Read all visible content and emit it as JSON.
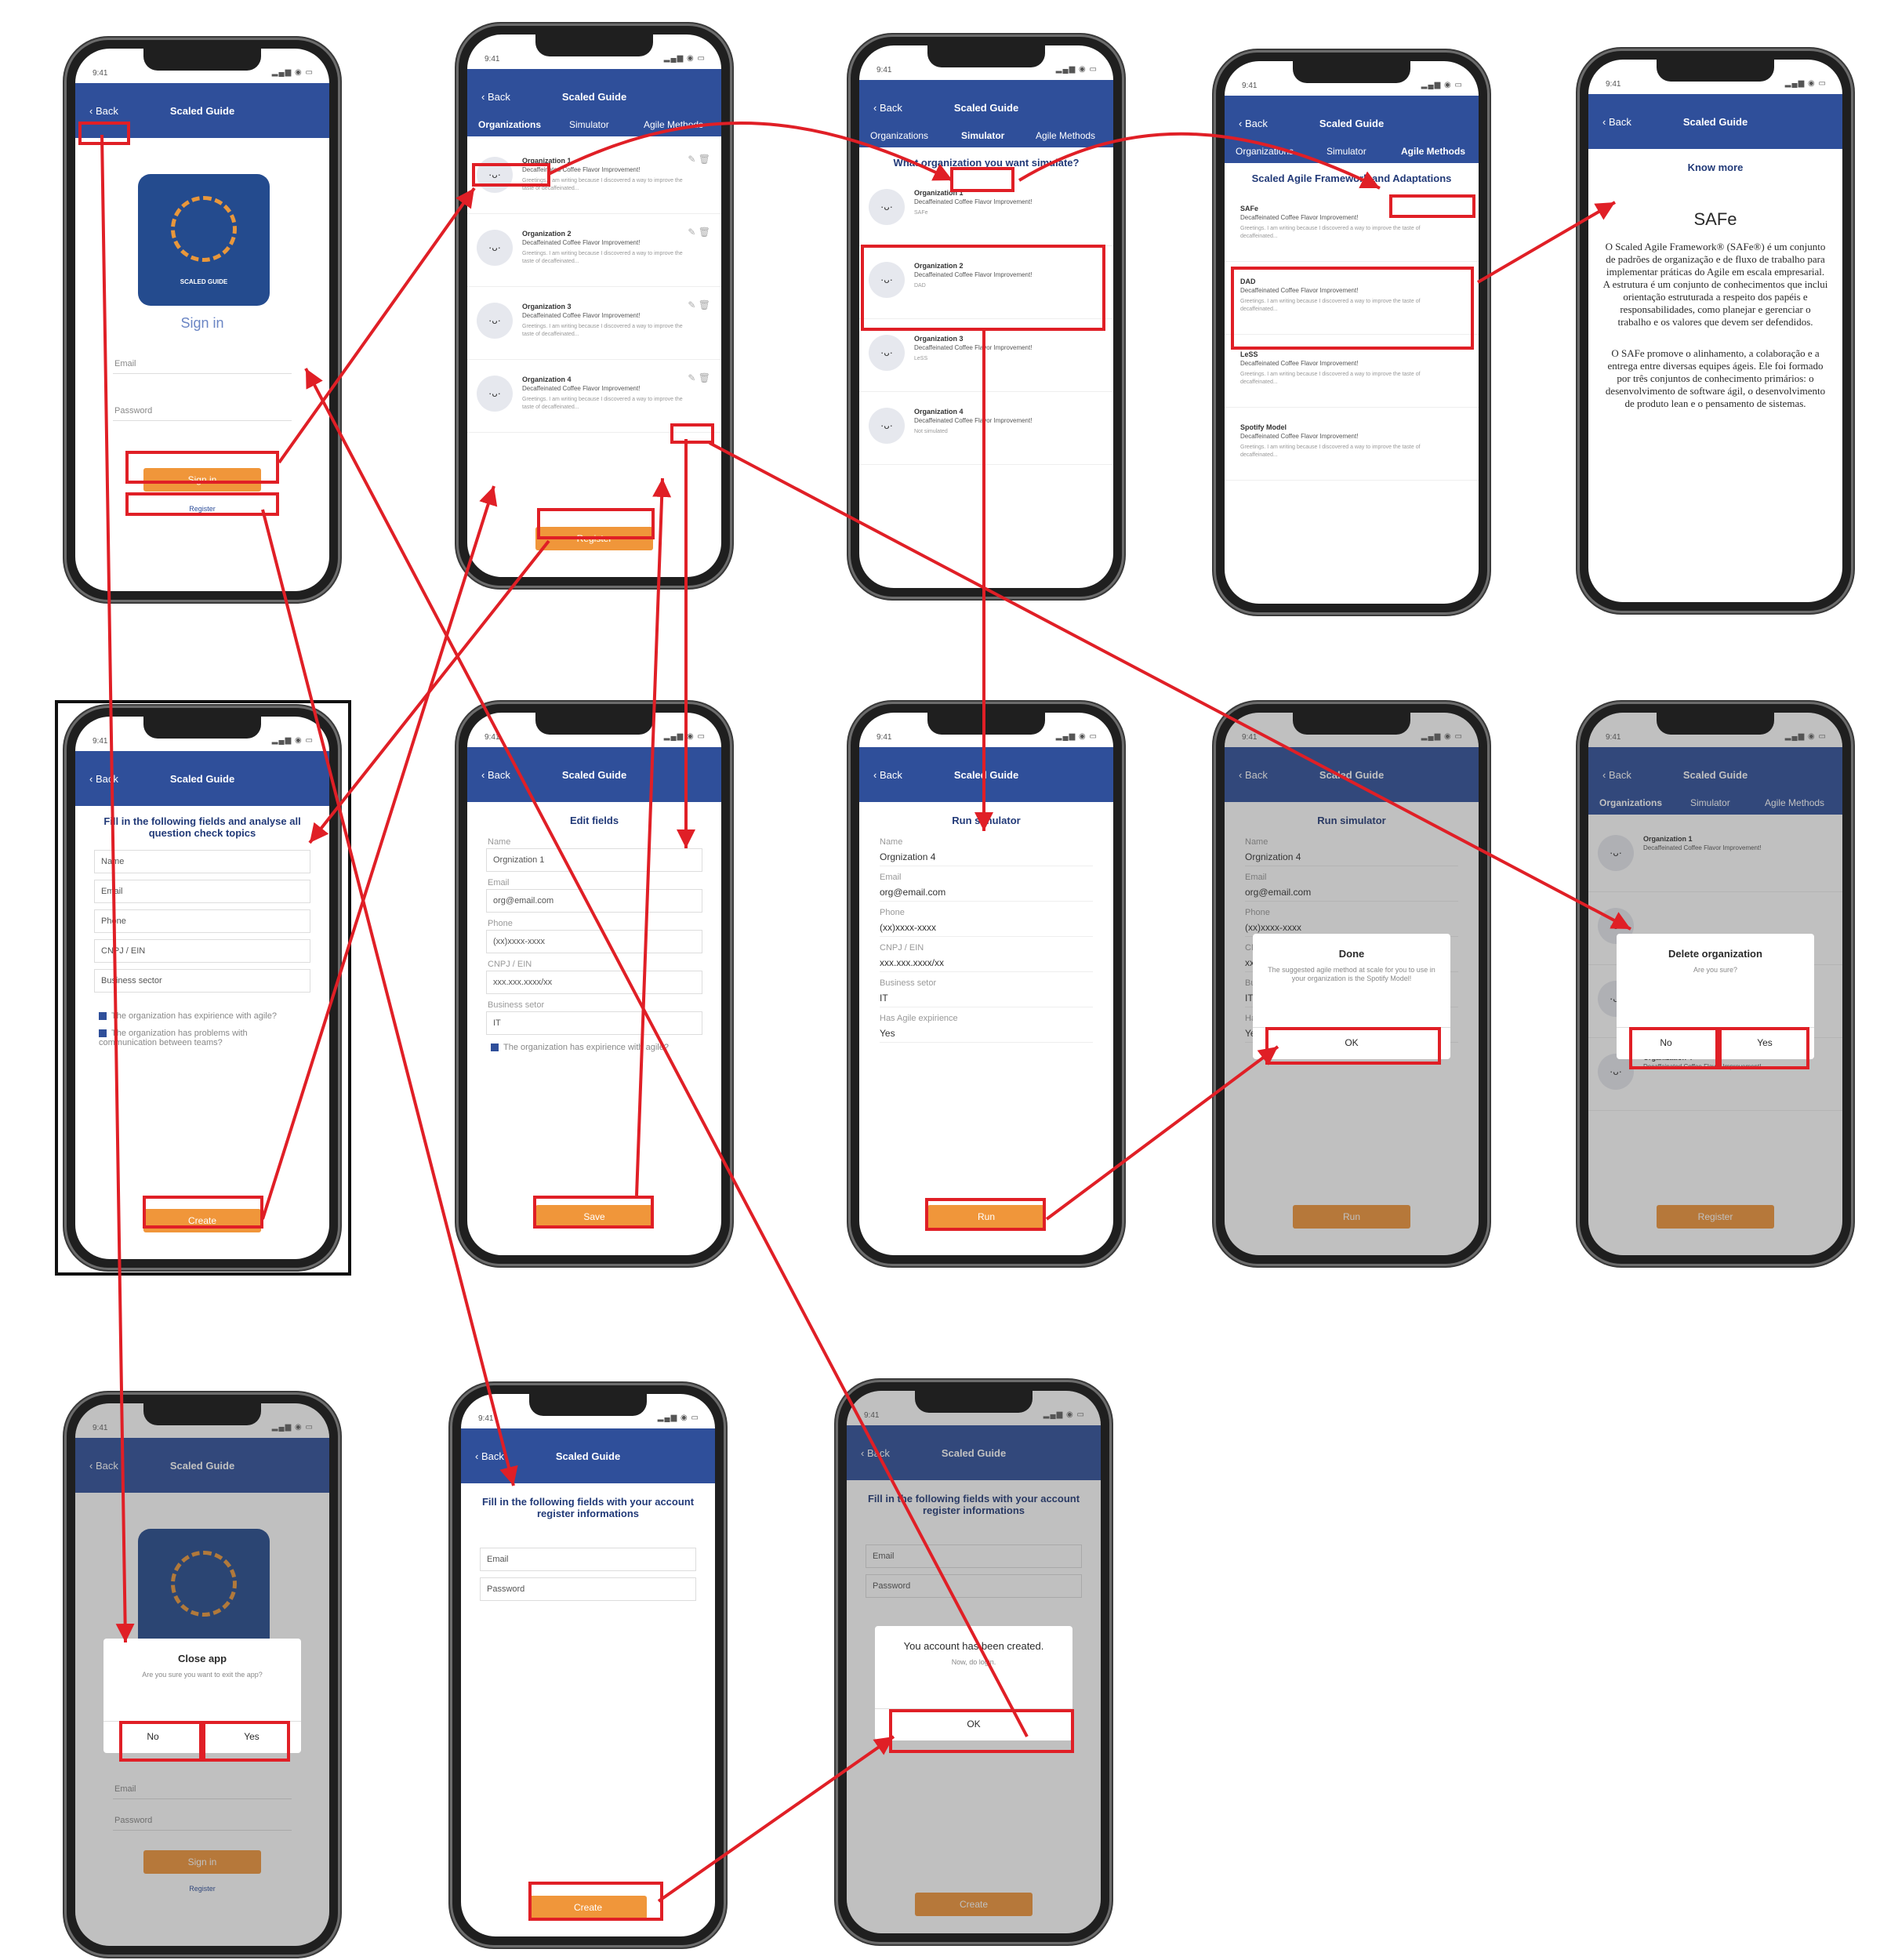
{
  "app": {
    "title": "Scaled Guide",
    "back_label": "Back",
    "time": "9:41",
    "logo_text": "SCALED GUIDE"
  },
  "tabs": {
    "organizations": "Organizations",
    "simulator": "Simulator",
    "agile_methods": "Agile Methods"
  },
  "signin": {
    "heading": "Sign in",
    "email_placeholder": "Email",
    "password_placeholder": "Password",
    "signin_button": "Sign in",
    "register_link": "Register"
  },
  "organizations": {
    "items": [
      {
        "title": "Organization 1",
        "sub": "Decaffeinated Coffee Flavor Improvement!",
        "desc": "Greetings. I am writing because I discovered a way to improve the taste of decaffeinated..."
      },
      {
        "title": "Organization 2",
        "sub": "Decaffeinated Coffee Flavor Improvement!",
        "desc": "Greetings. I am writing because I discovered a way to improve the taste of decaffeinated..."
      },
      {
        "title": "Organization 3",
        "sub": "Decaffeinated Coffee Flavor Improvement!",
        "desc": "Greetings. I am writing because I discovered a way to improve the taste of decaffeinated..."
      },
      {
        "title": "Organization 4",
        "sub": "Decaffeinated Coffee Flavor Improvement!",
        "desc": "Greetings. I am writing because I discovered a way to improve the taste of decaffeinated..."
      }
    ],
    "register_button": "Register"
  },
  "simulator": {
    "heading": "What organization you want simulate?",
    "items": [
      {
        "title": "Organization 1",
        "sub": "Decaffeinated Coffee Flavor Improvement!",
        "tag": "SAFe"
      },
      {
        "title": "Organization 2",
        "sub": "Decaffeinated Coffee Flavor Improvement!",
        "tag": "DAD"
      },
      {
        "title": "Organization 3",
        "sub": "Decaffeinated Coffee Flavor Improvement!",
        "tag": "LeSS"
      },
      {
        "title": "Organization 4",
        "sub": "Decaffeinated Coffee Flavor Improvement!",
        "tag": "Not simulated"
      }
    ]
  },
  "agile_methods": {
    "heading": "Scaled Agile Framework and Adaptations",
    "items": [
      {
        "title": "SAFe",
        "sub": "Decaffeinated Coffee Flavor Improvement!"
      },
      {
        "title": "DAD",
        "sub": "Decaffeinated Coffee Flavor Improvement!"
      },
      {
        "title": "LeSS",
        "sub": "Decaffeinated Coffee Flavor Improvement!"
      },
      {
        "title": "Spotify Model",
        "sub": "Decaffeinated Coffee Flavor Improvement!"
      }
    ],
    "desc": "Greetings. I am writing because I discovered a way to improve the taste of decaffeinated..."
  },
  "know_more": {
    "heading": "Know more",
    "title": "SAFe",
    "p1": "O Scaled Agile Framework® (SAFe®) é um conjunto de padrões de organização e de fluxo de trabalho para implementar práticas do Agile em escala empresarial. A estrutura é um conjunto de conhecimentos que inclui orientação estruturada a respeito dos papéis e responsabilidades, como planejar e gerenciar o trabalho e os valores que devem ser defendidos.",
    "p2": "O SAFe promove o alinhamento, a colaboração e a entrega entre diversas equipes ágeis. Ele foi formado por três conjuntos de conhecimento primários: o desenvolvimento de software ágil, o desenvolvimento de produto lean e o pensamento de sistemas."
  },
  "create_org": {
    "heading": "Fill in the following fields and analyse all question check topics",
    "fields": [
      "Name",
      "Email",
      "Phone",
      "CNPJ / EIN",
      "Business sector"
    ],
    "checks": [
      "The organization has expirience with agile?",
      "The organization has problems with communication between teams?"
    ],
    "create_button": "Create"
  },
  "edit_org": {
    "heading": "Edit fields",
    "fields": [
      {
        "label": "Name",
        "value": "Orgnization 1"
      },
      {
        "label": "Email",
        "value": "org@email.com"
      },
      {
        "label": "Phone",
        "value": "(xx)xxxx-xxxx"
      },
      {
        "label": "CNPJ / EIN",
        "value": "xxx.xxx.xxxx/xx"
      },
      {
        "label": "Business setor",
        "value": "IT"
      }
    ],
    "check": "The organization has expirience with agile?",
    "save_button": "Save"
  },
  "run_sim": {
    "heading": "Run simulator",
    "fields": [
      {
        "label": "Name",
        "value": "Orgnization 4"
      },
      {
        "label": "Email",
        "value": "org@email.com"
      },
      {
        "label": "Phone",
        "value": "(xx)xxxx-xxxx"
      },
      {
        "label": "CNPJ / EIN",
        "value": "xxx.xxx.xxxx/xx"
      },
      {
        "label": "Business setor",
        "value": "IT"
      },
      {
        "label": "Has Agile expirience",
        "value": "Yes"
      }
    ],
    "run_button": "Run"
  },
  "done_dialog": {
    "title": "Done",
    "message": "The suggested agile method at scale for you to use in your organization is the Spotify Model!",
    "ok": "OK"
  },
  "delete_dialog": {
    "title": "Delete organization",
    "message": "Are you sure?",
    "no": "No",
    "yes": "Yes"
  },
  "close_dialog": {
    "title": "Close app",
    "message": "Are you sure you want to exit the app?",
    "no": "No",
    "yes": "Yes"
  },
  "register": {
    "heading": "Fill in the following fields with your account register informations",
    "email_placeholder": "Email",
    "password_placeholder": "Password",
    "create_button": "Create"
  },
  "created_dialog": {
    "title": "You account has been created.",
    "message": "Now, do login.",
    "ok": "OK"
  },
  "colors": {
    "navbar": "#2f4f9a",
    "accent": "#f0963a",
    "highlight": "#e01f26"
  }
}
